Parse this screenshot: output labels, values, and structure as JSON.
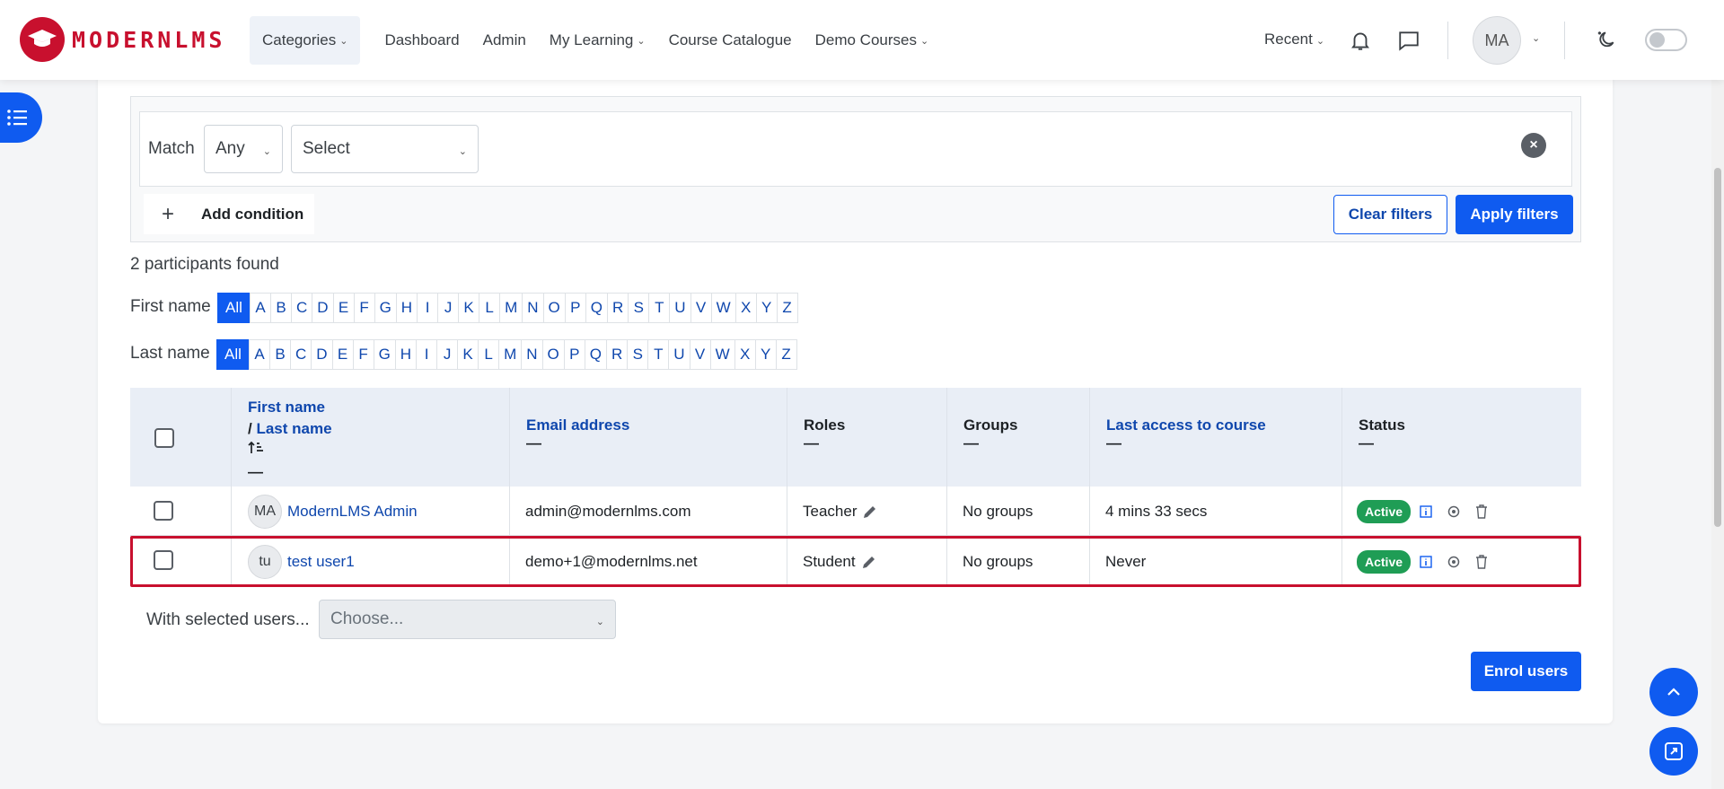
{
  "brand": {
    "name": "MODERNLMS"
  },
  "nav": {
    "items": [
      {
        "label": "Categories",
        "dropdown": true
      },
      {
        "label": "Dashboard",
        "dropdown": false
      },
      {
        "label": "Admin",
        "dropdown": false
      },
      {
        "label": "My Learning",
        "dropdown": true
      },
      {
        "label": "Course Catalogue",
        "dropdown": false
      },
      {
        "label": "Demo Courses",
        "dropdown": true
      }
    ],
    "recent": "Recent",
    "user_initials": "MA"
  },
  "filters": {
    "match_label": "Match",
    "match_value": "Any",
    "type_value": "Select",
    "add_condition": "Add condition",
    "clear": "Clear filters",
    "apply": "Apply filters"
  },
  "participants_found": "2 participants found",
  "initials_bar": {
    "first_label": "First name",
    "last_label": "Last name",
    "all": "All",
    "letters": [
      "A",
      "B",
      "C",
      "D",
      "E",
      "F",
      "G",
      "H",
      "I",
      "J",
      "K",
      "L",
      "M",
      "N",
      "O",
      "P",
      "Q",
      "R",
      "S",
      "T",
      "U",
      "V",
      "W",
      "X",
      "Y",
      "Z"
    ]
  },
  "table": {
    "headers": {
      "first_name": "First name",
      "slash": "/",
      "last_name": "Last name",
      "email": "Email address",
      "roles": "Roles",
      "groups": "Groups",
      "last_access": "Last access to course",
      "status": "Status",
      "dash": "—"
    },
    "rows": [
      {
        "initials": "MA",
        "name": "ModernLMS Admin",
        "email": "admin@modernlms.com",
        "role": "Teacher",
        "groups": "No groups",
        "last_access": "4 mins 33 secs",
        "status": "Active"
      },
      {
        "initials": "tu",
        "name": "test user1",
        "email": "demo+1@modernlms.net",
        "role": "Student",
        "groups": "No groups",
        "last_access": "Never",
        "status": "Active"
      }
    ]
  },
  "bulk": {
    "label": "With selected users...",
    "placeholder": "Choose..."
  },
  "enrol_button": "Enrol users",
  "colors": {
    "primary": "#0f5bf0",
    "brand": "#c8102e",
    "active": "#1f9d55",
    "highlight": "#c8102e"
  }
}
